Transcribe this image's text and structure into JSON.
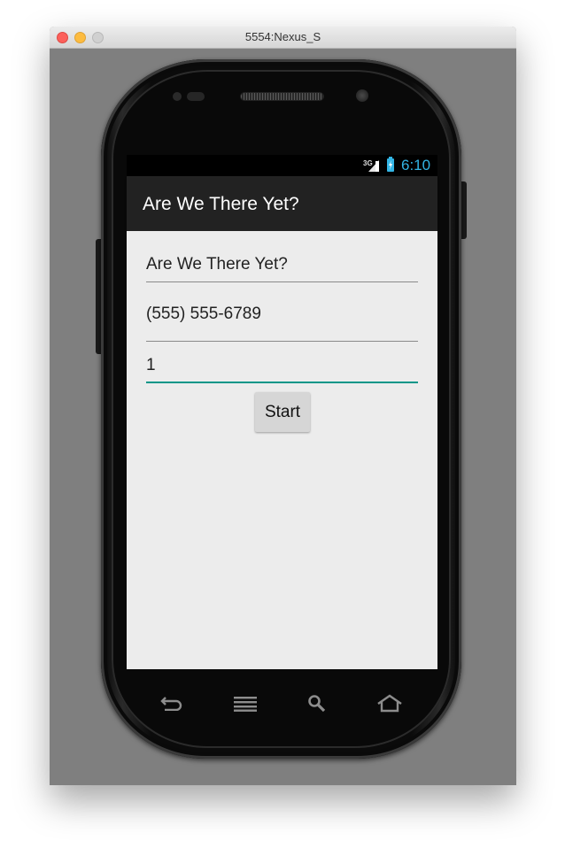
{
  "window": {
    "title": "5554:Nexus_S"
  },
  "status_bar": {
    "network_label": "3G",
    "time": "6:10",
    "accent_color": "#33b5e5"
  },
  "app": {
    "action_bar_title": "Are We There Yet?",
    "fields": {
      "message": "Are We There Yet?",
      "phone": "(555) 555-6789",
      "interval": "1"
    },
    "start_label": "Start",
    "focus_color": "#009688"
  },
  "hardware_keys": [
    "back-icon",
    "menu-icon",
    "search-icon",
    "home-icon"
  ]
}
